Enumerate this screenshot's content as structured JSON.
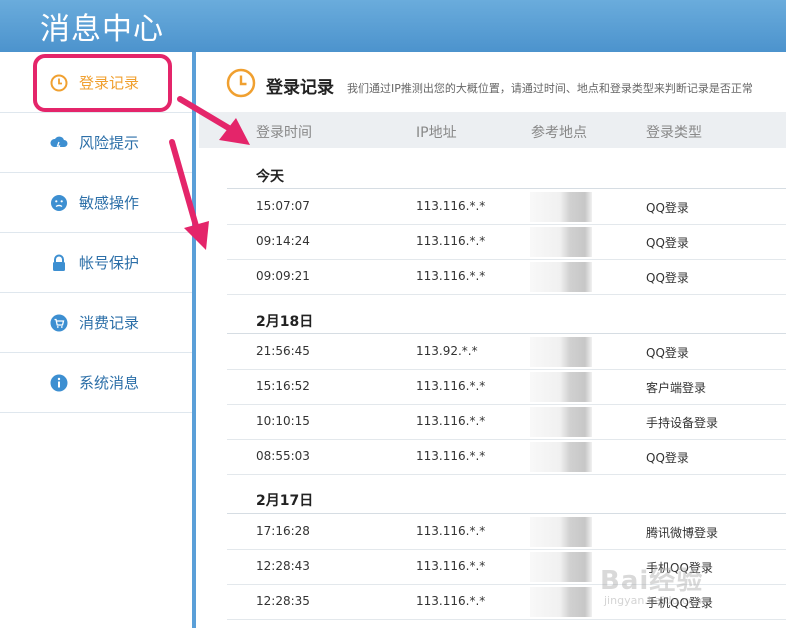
{
  "header": {
    "title": "消息中心"
  },
  "sidebar": {
    "items": [
      {
        "label": "登录记录",
        "icon": "clock-icon"
      },
      {
        "label": "风险提示",
        "icon": "cloud-alert-icon"
      },
      {
        "label": "敏感操作",
        "icon": "face-icon"
      },
      {
        "label": "帐号保护",
        "icon": "lock-icon"
      },
      {
        "label": "消费记录",
        "icon": "cart-icon"
      },
      {
        "label": "系统消息",
        "icon": "info-icon"
      }
    ]
  },
  "main": {
    "title": "登录记录",
    "description": "我们通过IP推测出您的大概位置，请通过时间、地点和登录类型来判断记录是否正常",
    "columns": [
      "登录时间",
      "IP地址",
      "参考地点",
      "登录类型"
    ],
    "groups": [
      {
        "title": "今天",
        "rows": [
          {
            "time": "15:07:07",
            "ip": "113.116.*.*",
            "type": "QQ登录"
          },
          {
            "time": "09:14:24",
            "ip": "113.116.*.*",
            "type": "QQ登录"
          },
          {
            "time": "09:09:21",
            "ip": "113.116.*.*",
            "type": "QQ登录"
          }
        ]
      },
      {
        "title": "2月18日",
        "rows": [
          {
            "time": "21:56:45",
            "ip": "113.92.*.*",
            "type": "QQ登录"
          },
          {
            "time": "15:16:52",
            "ip": "113.116.*.*",
            "type": "客户端登录"
          },
          {
            "time": "10:10:15",
            "ip": "113.116.*.*",
            "type": "手持设备登录"
          },
          {
            "time": "08:55:03",
            "ip": "113.116.*.*",
            "type": "QQ登录"
          }
        ]
      },
      {
        "title": "2月17日",
        "rows": [
          {
            "time": "17:16:28",
            "ip": "113.116.*.*",
            "type": "腾讯微博登录"
          },
          {
            "time": "12:28:43",
            "ip": "113.116.*.*",
            "type": "手机QQ登录"
          },
          {
            "time": "12:28:35",
            "ip": "113.116.*.*",
            "type": "手机QQ登录"
          }
        ]
      }
    ]
  },
  "watermark": {
    "text": "Bai经验",
    "sub": "jingyan.baidu.com"
  },
  "colors": {
    "header": "#4c93cd",
    "accent": "#f0a030",
    "highlight": "#e4256a",
    "nav_text": "#2c6fa8"
  }
}
